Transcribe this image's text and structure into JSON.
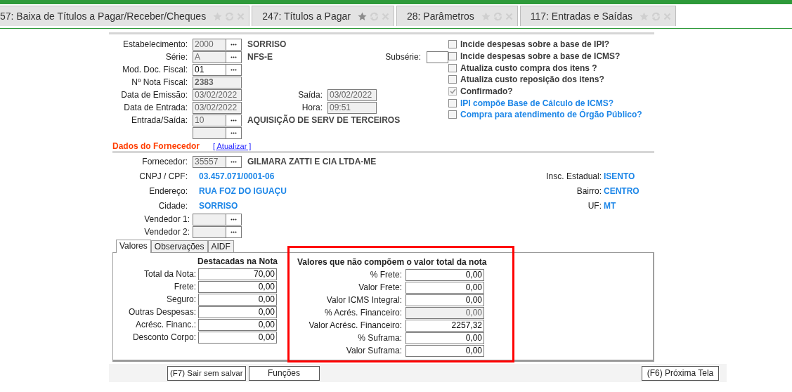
{
  "tabs": [
    {
      "label": "57: Baixa de Títulos a Pagar/Receber/Cheques",
      "favorite": false
    },
    {
      "label": "247: Títulos a Pagar",
      "favorite": true
    },
    {
      "label": "28: Parâmetros",
      "favorite": false
    },
    {
      "label": "117: Entradas e Saídas",
      "favorite": false
    }
  ],
  "header": {
    "rows": [
      {
        "label": "Estabelecimento:",
        "value": "2000",
        "disabled": true,
        "lookup": true,
        "description": "SORRISO"
      },
      {
        "label": "Série:",
        "value": "A",
        "disabled": true,
        "lookup": true,
        "description": "NFS-E"
      },
      {
        "label": "Mod. Doc. Fiscal:",
        "value": "01",
        "disabled": false,
        "lookup": true
      },
      {
        "label": "Nº Nota Fiscal:",
        "value": "2383",
        "disabled": true,
        "lookup": false,
        "bold": true
      },
      {
        "label": "Data de Emissão:",
        "value": "03/02/2022",
        "disabled": true,
        "lookup": false,
        "extra": {
          "label": "Saída:",
          "value": "03/02/2022",
          "disabled": true
        }
      },
      {
        "label": "Data de Entrada:",
        "value": "03/02/2022",
        "disabled": true,
        "lookup": false,
        "extra": {
          "label": "Hora:",
          "value": "09:51",
          "disabled": true
        }
      },
      {
        "label": "Entrada/Saída:",
        "value": "10",
        "disabled": true,
        "lookup": true,
        "description": "AQUISIÇÃO DE SERV DE TERCEIROS"
      },
      {
        "disabled": true,
        "lookup": true
      }
    ],
    "subserie": {
      "label": "Subsérie:",
      "disabled": false
    },
    "checks": [
      {
        "label": "Incide despesas sobre a base de IPI?",
        "checked": false,
        "disabled": false,
        "kind": "plain"
      },
      {
        "label": "Incide despesas sobre a base de ICMS?",
        "checked": false,
        "disabled": false,
        "kind": "plain"
      },
      {
        "label": "Atualiza custo compra dos itens ?",
        "checked": false,
        "disabled": false,
        "kind": "plain"
      },
      {
        "label": "Atualiza custo reposição dos itens?",
        "checked": false,
        "disabled": false,
        "kind": "plain"
      },
      {
        "label": "Confirmado?",
        "checked": true,
        "disabled": true,
        "kind": "plain"
      },
      {
        "label": "IPI compõe Base de Cálculo de ICMS?",
        "checked": false,
        "disabled": false,
        "kind": "link"
      },
      {
        "label": "Compra para atendimento de Órgão Público?",
        "checked": false,
        "disabled": false,
        "kind": "link"
      }
    ]
  },
  "supplier": {
    "title": "Dados do Fornecedor",
    "refresh_link": "[ Atualizar ]",
    "supplier_field": {
      "label": "Fornecedor:",
      "value": "35557",
      "disabled": true,
      "description": "GILMARA ZATTI E CIA LTDA-ME"
    },
    "info_left": [
      {
        "label": "CNPJ / CPF:",
        "value": "03.457.071/0001-06"
      },
      {
        "label": "Endereço:",
        "value": "RUA FOZ DO IGUAÇU"
      },
      {
        "label": "Cidade:",
        "value": "SORRISO"
      }
    ],
    "info_right": [
      {
        "label": "Insc. Estadual:",
        "value": "ISENTO"
      },
      {
        "label": "Bairro:",
        "value": "CENTRO"
      },
      {
        "label": "UF:",
        "value": "MT"
      }
    ],
    "sellers": [
      {
        "label": "Vendedor 1:",
        "disabled": true
      },
      {
        "label": "Vendedor 2:",
        "disabled": true
      }
    ]
  },
  "value_tabs": [
    {
      "label": "Valores",
      "selected": true
    },
    {
      "label": "Observações",
      "selected": false
    },
    {
      "label": "AIDF",
      "selected": false
    }
  ],
  "groups": [
    {
      "title": "Destacadas na Nota",
      "highlighted": false,
      "rows": [
        {
          "label": "Total da Nota:",
          "value": "70,00",
          "disabled": false
        },
        {
          "label": "Frete:",
          "value": "0,00",
          "disabled": false
        },
        {
          "label": "Seguro:",
          "value": "0,00",
          "disabled": false
        },
        {
          "label": "Outras Despesas:",
          "value": "0,00",
          "disabled": false
        },
        {
          "label": "Acrésc. Financ.:",
          "value": "0,00",
          "disabled": false
        },
        {
          "label": "Desconto Corpo:",
          "value": "0,00",
          "disabled": false
        }
      ]
    },
    {
      "title": "Valores que não compõem o valor total da nota",
      "highlighted": true,
      "rows": [
        {
          "label": "% Frete:",
          "value": "0,00",
          "disabled": false
        },
        {
          "label": "Valor Frete:",
          "value": "0,00",
          "disabled": false
        },
        {
          "label": "Valor ICMS Integral:",
          "value": "0,00",
          "disabled": false
        },
        {
          "label": "% Acrés. Financeiro:",
          "value": "0,00",
          "disabled": true
        },
        {
          "label": "Valor Acrésc. Financeiro:",
          "value": "2257,32",
          "disabled": false
        },
        {
          "label": "% Suframa:",
          "value": "0,00",
          "disabled": false
        },
        {
          "label": "Valor Suframa:",
          "value": "0,00",
          "disabled": false
        }
      ]
    }
  ],
  "footer": {
    "left_buttons": [
      "(F7) Sair sem salvar",
      "Funções"
    ],
    "right_buttons": [
      "(F6) Próxima Tela"
    ]
  }
}
